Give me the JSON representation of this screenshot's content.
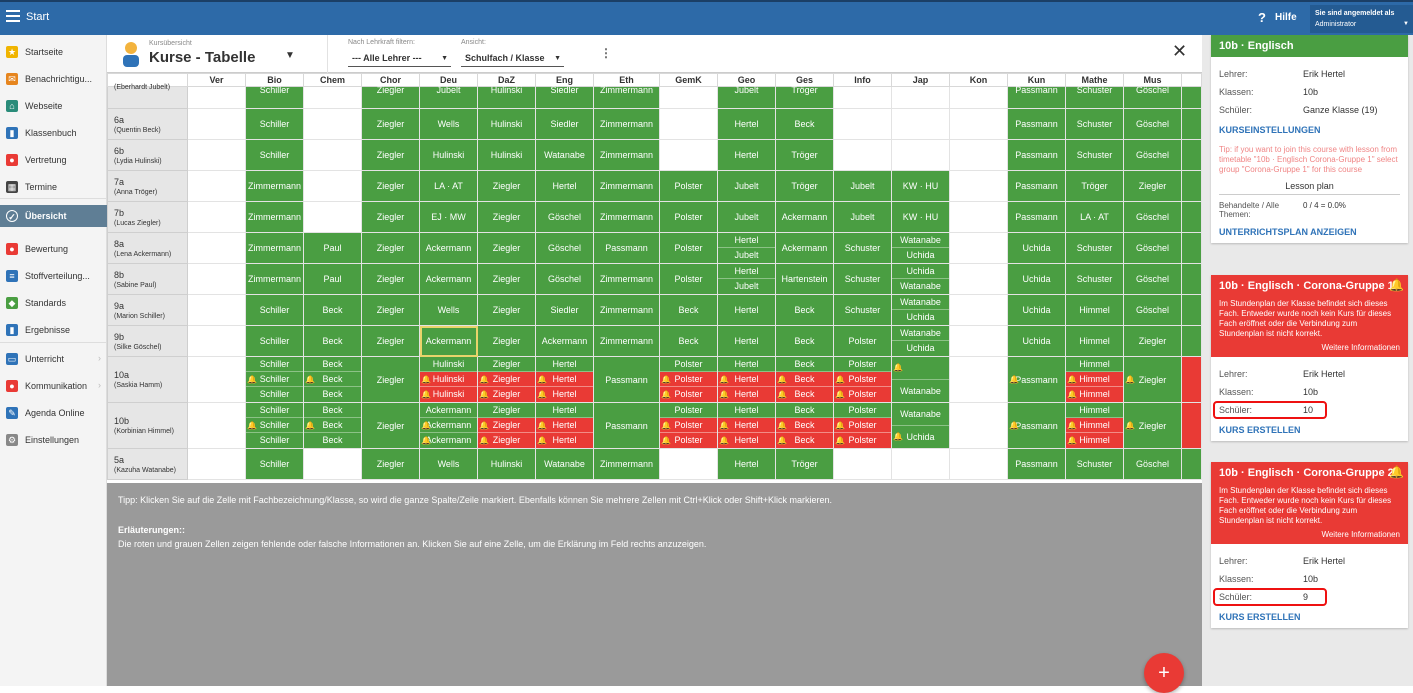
{
  "topbar": {
    "app_title": "Start",
    "help": "Hilfe",
    "login_label": "Sie sind angemeldet als",
    "login_user": "Administrator"
  },
  "sidebar": {
    "items": [
      {
        "label": "Startseite",
        "icon": "star-icon",
        "color": "#f0b400",
        "glyph": "★"
      },
      {
        "label": "Benachrichtigu...",
        "icon": "mail-icon",
        "color": "#e6851e",
        "glyph": "✉"
      },
      {
        "label": "Webseite",
        "icon": "home-icon",
        "color": "#2a8c7a",
        "glyph": "⌂"
      },
      {
        "label": "Klassenbuch",
        "icon": "book-icon",
        "color": "#2f73b8",
        "glyph": "▮"
      },
      {
        "label": "Vertretung",
        "icon": "person-icon",
        "color": "#e93a35",
        "glyph": "●"
      },
      {
        "label": "Termine",
        "icon": "calendar-icon",
        "color": "#444444",
        "glyph": "▦"
      },
      {
        "label": "Übersicht",
        "icon": "check-icon",
        "color": "#ffffff",
        "glyph": "✓"
      },
      {
        "label": "Bewertung",
        "icon": "rating-icon",
        "color": "#e93a35",
        "glyph": "●"
      },
      {
        "label": "Stoffverteilung...",
        "icon": "list-icon",
        "color": "#2f73b8",
        "glyph": "≡"
      },
      {
        "label": "Standards",
        "icon": "shield-icon",
        "color": "#4a9e42",
        "glyph": "◆"
      },
      {
        "label": "Ergebnisse",
        "icon": "bar-chart-icon",
        "color": "#2f73b8",
        "glyph": "▮"
      },
      {
        "label": "Unterricht",
        "icon": "monitor-icon",
        "color": "#2f73b8",
        "glyph": "▭"
      },
      {
        "label": "Kommunikation",
        "icon": "chat-icon",
        "color": "#e93a35",
        "glyph": "●"
      },
      {
        "label": "Agenda Online",
        "icon": "pen-icon",
        "color": "#2f73b8",
        "glyph": "✎"
      },
      {
        "label": "Einstellungen",
        "icon": "gear-icon",
        "color": "#888888",
        "glyph": "⚙"
      }
    ]
  },
  "header": {
    "supertitle": "Kursübersicht",
    "title": "Kurse - Tabelle",
    "filter_label": "Nach Lehrkraft filtern:",
    "filter_value": "--- Alle Lehrer ---",
    "view_label": "Ansicht:",
    "view_value": "Schulfach / Klasse"
  },
  "table": {
    "columns": [
      "Ver",
      "Bio",
      "Chem",
      "Chor",
      "Deu",
      "DaZ",
      "Eng",
      "Eth",
      "GemK",
      "Geo",
      "Ges",
      "Info",
      "Jap",
      "Kon",
      "Kun",
      "Mathe",
      "Mus",
      ""
    ],
    "rows": [
      {
        "k": "",
        "t": "(Eberhardt Jubelt)",
        "c": [
          "e",
          "Schiller",
          "e",
          "Ziegler",
          "Jubelt",
          "Hulinski",
          "Siedler",
          "Zimmermann",
          "e",
          "Jubelt",
          "Tröger",
          "e",
          "e",
          "e",
          "Passmann",
          "Schuster",
          "Göschel",
          "g"
        ]
      },
      {
        "k": "6a",
        "t": "(Quentin Beck)",
        "c": [
          "e",
          "Schiller",
          "e",
          "Ziegler",
          "Wells",
          "Hulinski",
          "Siedler",
          "Zimmermann",
          "e",
          "Hertel",
          "Beck",
          "e",
          "e",
          "e",
          "Passmann",
          "Schuster",
          "Göschel",
          "g"
        ]
      },
      {
        "k": "6b",
        "t": "(Lydia Hulinski)",
        "c": [
          "e",
          "Schiller",
          "e",
          "Ziegler",
          "Hulinski",
          "Hulinski",
          "Watanabe",
          "Zimmermann",
          "e",
          "Hertel",
          "Tröger",
          "e",
          "e",
          "e",
          "Passmann",
          "Schuster",
          "Göschel",
          "g"
        ]
      },
      {
        "k": "7a",
        "t": "(Anna Tröger)",
        "c": [
          "e",
          "Zimmermann",
          "e",
          "Ziegler",
          "LA · AT",
          "Ziegler",
          "Hertel",
          "Zimmermann",
          "Polster",
          "Jubelt",
          "Tröger",
          "Jubelt",
          "KW · HU",
          "e",
          "Passmann",
          "Tröger",
          "Ziegler",
          "g"
        ]
      },
      {
        "k": "7b",
        "t": "(Lucas Ziegler)",
        "c": [
          "e",
          "Zimmermann",
          "e",
          "Ziegler",
          "EJ · MW",
          "Ziegler",
          "Göschel",
          "Zimmermann",
          "Polster",
          "Jubelt",
          "Ackermann",
          "Jubelt",
          "KW · HU",
          "e",
          "Passmann",
          "LA · AT",
          "Göschel",
          "g"
        ]
      },
      {
        "k": "8a",
        "t": "(Lena Ackermann)",
        "c": [
          "e",
          "Zimmermann",
          "Paul",
          "Ziegler",
          "Ackermann",
          "Ziegler",
          "Göschel",
          "Passmann",
          "Polster",
          [
            "Hertel",
            "Jubelt"
          ],
          "Ackermann",
          "Schuster",
          [
            "Watanabe",
            "Uchida"
          ],
          "e",
          "Uchida",
          "Schuster",
          "Göschel",
          "g"
        ]
      },
      {
        "k": "8b",
        "t": "(Sabine Paul)",
        "c": [
          "e",
          "Zimmermann",
          "Paul",
          "Ziegler",
          "Ackermann",
          "Ziegler",
          "Göschel",
          "Zimmermann",
          "Polster",
          [
            "Hertel",
            "Jubelt"
          ],
          "Hartenstein",
          "Schuster",
          [
            "Uchida",
            "Watanabe"
          ],
          "e",
          "Uchida",
          "Schuster",
          "Göschel",
          "g"
        ]
      },
      {
        "k": "9a",
        "t": "(Marion Schiller)",
        "c": [
          "e",
          "Schiller",
          "Beck",
          "Ziegler",
          "Wells",
          "Ziegler",
          "Siedler",
          "Zimmermann",
          "Beck",
          "Hertel",
          "Beck",
          "Schuster",
          [
            "Watanabe",
            "Uchida"
          ],
          "e",
          "Uchida",
          "Himmel",
          "Göschel",
          "g"
        ]
      },
      {
        "k": "9b",
        "t": "(Silke Göschel)",
        "c": [
          "e",
          "Schiller",
          "Beck",
          "Ziegler",
          "Ackermann",
          "Ziegler",
          "Ackermann",
          "Zimmermann",
          "Beck",
          "Hertel",
          "Beck",
          "Polster",
          [
            "Watanabe",
            "Uchida"
          ],
          "e",
          "Uchida",
          "Himmel",
          "Ziegler",
          "g"
        ]
      },
      {
        "k": "10a",
        "t": "(Saskia Hamm)",
        "c": [
          "e",
          [
            "Schiller",
            "!Schiller",
            "Schiller"
          ],
          [
            "Beck",
            "!Beck",
            "Beck"
          ],
          "Ziegler",
          [
            "Hulinski",
            "#Hulinski",
            "#Hulinski"
          ],
          [
            "Ziegler",
            "#Ziegler",
            "#Ziegler"
          ],
          [
            "Hertel",
            "#Hertel",
            "#Hertel"
          ],
          "Passmann",
          [
            "Polster",
            "#Polster",
            "#Polster"
          ],
          [
            "Hertel",
            "#Hertel",
            "#Hertel"
          ],
          [
            "Beck",
            "#Beck",
            "#Beck"
          ],
          [
            "Polster",
            "#Polster",
            "#Polster"
          ],
          [
            "!",
            "Watanabe"
          ],
          "e",
          "!Passmann",
          [
            "Himmel",
            "#Himmel",
            "#Himmel"
          ],
          "!Ziegler",
          "r"
        ]
      },
      {
        "k": "10b",
        "t": "(Korbinian Himmel)",
        "c": [
          "e",
          [
            "Schiller",
            "!Schiller",
            "Schiller"
          ],
          [
            "Beck",
            "!Beck",
            "Beck"
          ],
          "Ziegler",
          [
            "Ackermann",
            "!Ackermann",
            "!Ackermann"
          ],
          [
            "Ziegler",
            "#Ziegler",
            "#Ziegler"
          ],
          [
            "Hertel",
            "#Hertel",
            "#Hertel"
          ],
          "Passmann",
          [
            "Polster",
            "#Polster",
            "#Polster"
          ],
          [
            "Hertel",
            "#Hertel",
            "#Hertel"
          ],
          [
            "Beck",
            "#Beck",
            "#Beck"
          ],
          [
            "Polster",
            "#Polster",
            "#Polster"
          ],
          [
            "Watanabe",
            "!Uchida"
          ],
          "e",
          "!Passmann",
          [
            "Himmel",
            "#Himmel",
            "#Himmel"
          ],
          "!Ziegler",
          "r"
        ]
      },
      {
        "k": "5a",
        "t": "(Kazuha Watanabe)",
        "c": [
          "e",
          "Schiller",
          "e",
          "Ziegler",
          "Wells",
          "Hulinski",
          "Watanabe",
          "Zimmermann",
          "e",
          "Hertel",
          "Tröger",
          "e",
          "e",
          "e",
          "Passmann",
          "Schuster",
          "Göschel",
          "g"
        ]
      }
    ]
  },
  "info": {
    "tip": "Tipp: Klicken Sie auf die Zelle mit Fachbezeichnung/Klasse, so wird die ganze Spalte/Zeile markiert. Ebenfalls können Sie mehrere Zellen mit Ctrl+Klick oder Shift+Klick markieren.",
    "heading": "Erläuterungen::",
    "text": "Die roten und grauen Zellen zeigen fehlende oder falsche Informationen an. Klicken Sie auf eine Zelle, um die Erklärung im Feld rechts anzuzeigen."
  },
  "fab": "+",
  "panel": {
    "card1": {
      "title": "10b · Englisch",
      "teacher_k": "Lehrer:",
      "teacher_v": "Erik Hertel",
      "class_k": "Klassen:",
      "class_v": "10b",
      "students_k": "Schüler:",
      "students_v": "Ganze Klasse (19)",
      "link": "KURSEINSTELLUNGEN",
      "tip": "Tip: if you want to join this course with lesson from timetable \"10b · Englisch Corona-Gruppe 1\" select group \"Corona-Gruppe 1\" for this course",
      "lp": "Lesson plan",
      "prog_k": "Behandelte / Alle Themen:",
      "prog_v": "0 / 4 = 0.0%",
      "link2": "UNTERRICHTSPLAN ANZEIGEN"
    },
    "card2": {
      "title": "10b · Englisch · Corona-Gruppe 1",
      "warn": "Im Stundenplan der Klasse befindet sich dieses Fach. Entweder wurde noch kein Kurs für dieses Fach eröffnet oder die Verbindung zum Stundenplan ist nicht korrekt.",
      "more": "Weitere Informationen",
      "teacher_k": "Lehrer:",
      "teacher_v": "Erik Hertel",
      "class_k": "Klassen:",
      "class_v": "10b",
      "students_k": "Schüler:",
      "students_v": "10",
      "link": "KURS ERSTELLEN"
    },
    "card3": {
      "title": "10b · Englisch · Corona-Gruppe 2",
      "warn": "Im Stundenplan der Klasse befindet sich dieses Fach. Entweder wurde noch kein Kurs für dieses Fach eröffnet oder die Verbindung zum Stundenplan ist nicht korrekt.",
      "more": "Weitere Informationen",
      "teacher_k": "Lehrer:",
      "teacher_v": "Erik Hertel",
      "class_k": "Klassen:",
      "class_v": "10b",
      "students_k": "Schüler:",
      "students_v": "9",
      "link": "KURS ERSTELLEN"
    }
  }
}
